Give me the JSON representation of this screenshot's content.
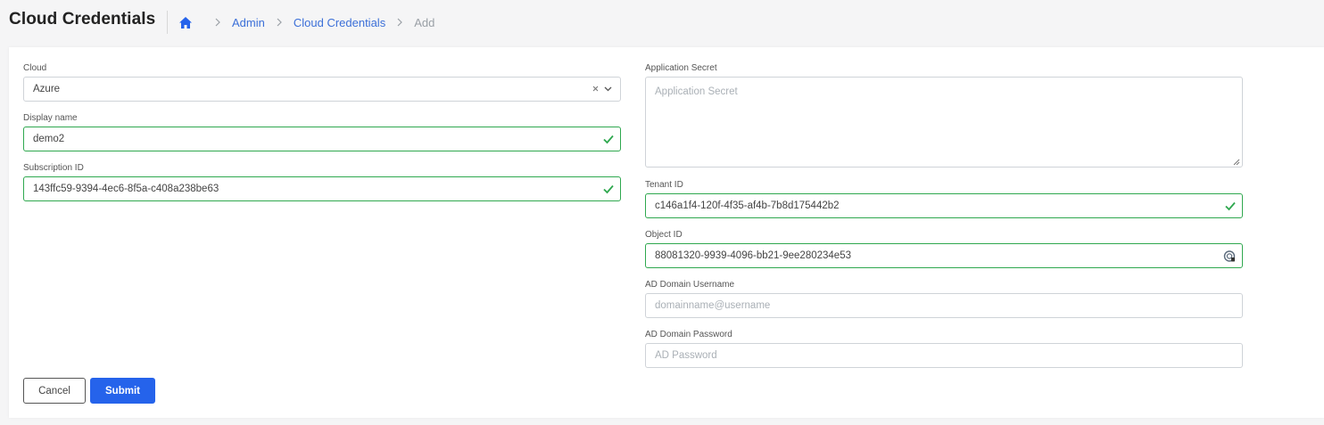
{
  "header": {
    "title": "Cloud Credentials",
    "breadcrumb": [
      {
        "label": "Admin",
        "type": "link"
      },
      {
        "label": "Cloud Credentials",
        "type": "link"
      },
      {
        "label": "Add",
        "type": "current"
      }
    ]
  },
  "form": {
    "cloud": {
      "label": "Cloud",
      "value": "Azure"
    },
    "display_name": {
      "label": "Display name",
      "value": "demo2"
    },
    "subscription_id": {
      "label": "Subscription ID",
      "value": "143ffc59-9394-4ec6-8f5a-c408a238be63"
    },
    "application_secret": {
      "label": "Application Secret",
      "placeholder": "Application Secret"
    },
    "tenant_id": {
      "label": "Tenant ID",
      "value": "c146a1f4-120f-4f35-af4b-7b8d175442b2"
    },
    "object_id": {
      "label": "Object ID",
      "value": "88081320-9939-4096-bb21-9ee280234e53"
    },
    "ad_username": {
      "label": "AD Domain Username",
      "placeholder": "domainname@username"
    },
    "ad_password": {
      "label": "AD Domain Password",
      "placeholder": "AD Password"
    }
  },
  "actions": {
    "cancel_label": "Cancel",
    "submit_label": "Submit"
  },
  "colors": {
    "accent": "#2563eb",
    "valid": "#2fa84f",
    "link": "#3b6fd8"
  },
  "icons": {
    "home": "home-icon",
    "separator": "chevron-right-icon",
    "valid": "check-icon",
    "clear": "clear-icon",
    "dropdown": "chevron-down-icon",
    "lookup": "lookup-icon"
  }
}
